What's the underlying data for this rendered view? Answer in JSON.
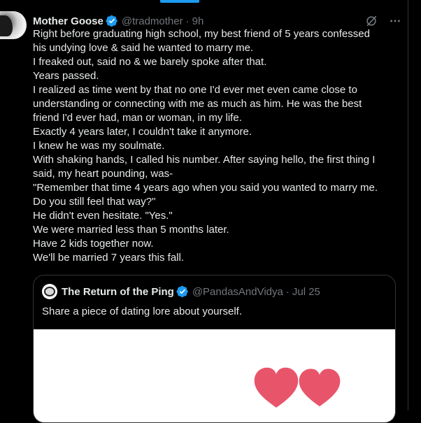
{
  "tweet": {
    "author": {
      "display_name": "Mother Goose",
      "handle": "@tradmother",
      "time": "9h",
      "verified": true
    },
    "actions": {
      "grok_icon": "grok-icon",
      "more_icon": "more-icon"
    },
    "body_lines": [
      "Right before graduating high school, my best friend of 5 years confessed",
      "his undying love & said he wanted to marry me.",
      "I freaked out, said no & we barely spoke after that.",
      "Years passed.",
      "I realized as time went by that no one I'd ever met even came close to",
      "understanding or connecting with me as much as him. He was the best",
      "friend I'd ever had, man or woman, in my life.",
      "Exactly 4 years later, I couldn't take it anymore.",
      "I knew he was my soulmate.",
      "With shaking hands, I called his number. After saying hello, the first thing I",
      "said, my heart pounding, was-",
      "\"Remember that time 4 years ago when you said you wanted to marry me.",
      "Do you still feel that way?\"",
      "He didn't even hesitate. \"Yes.\"",
      "We were married less than 5 months later.",
      "Have 2 kids together now.",
      "We'll be married 7 years this fall."
    ],
    "quote": {
      "display_name": "The Return of the Ping",
      "handle": "@PandasAndVidya",
      "time": "Jul 25",
      "verified": true,
      "text": "Share a piece of dating lore about yourself."
    }
  },
  "colors": {
    "background": "#000000",
    "text": "#e7e9ea",
    "secondary_text": "#71767b",
    "accent": "#1d9bf0",
    "border": "#2f3336",
    "heart": "#e8556a"
  }
}
